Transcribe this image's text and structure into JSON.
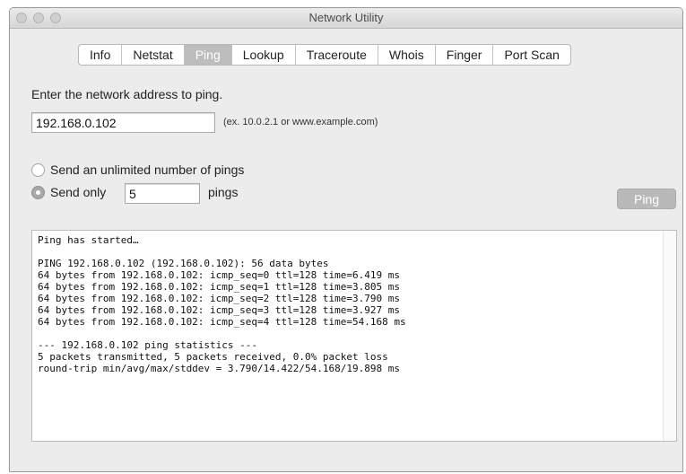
{
  "window": {
    "title": "Network Utility"
  },
  "tabs": [
    {
      "label": "Info"
    },
    {
      "label": "Netstat"
    },
    {
      "label": "Ping",
      "active": true
    },
    {
      "label": "Lookup"
    },
    {
      "label": "Traceroute"
    },
    {
      "label": "Whois"
    },
    {
      "label": "Finger"
    },
    {
      "label": "Port Scan"
    }
  ],
  "ping": {
    "prompt": "Enter the network address to ping.",
    "address_value": "192.168.0.102",
    "address_hint": "(ex. 10.0.2.1 or www.example.com)",
    "option_unlimited_label": "Send an unlimited number of pings",
    "option_only_label": "Send only",
    "count_value": "5",
    "pings_suffix": "pings",
    "selected_option": "send_only",
    "button_label": "Ping"
  },
  "output": {
    "lines": [
      "Ping has started…",
      "",
      "PING 192.168.0.102 (192.168.0.102): 56 data bytes",
      "64 bytes from 192.168.0.102: icmp_seq=0 ttl=128 time=6.419 ms",
      "64 bytes from 192.168.0.102: icmp_seq=1 ttl=128 time=3.805 ms",
      "64 bytes from 192.168.0.102: icmp_seq=2 ttl=128 time=3.790 ms",
      "64 bytes from 192.168.0.102: icmp_seq=3 ttl=128 time=3.927 ms",
      "64 bytes from 192.168.0.102: icmp_seq=4 ttl=128 time=54.168 ms",
      "",
      "--- 192.168.0.102 ping statistics ---",
      "5 packets transmitted, 5 packets received, 0.0% packet loss",
      "round-trip min/avg/max/stddev = 3.790/14.422/54.168/19.898 ms"
    ]
  }
}
